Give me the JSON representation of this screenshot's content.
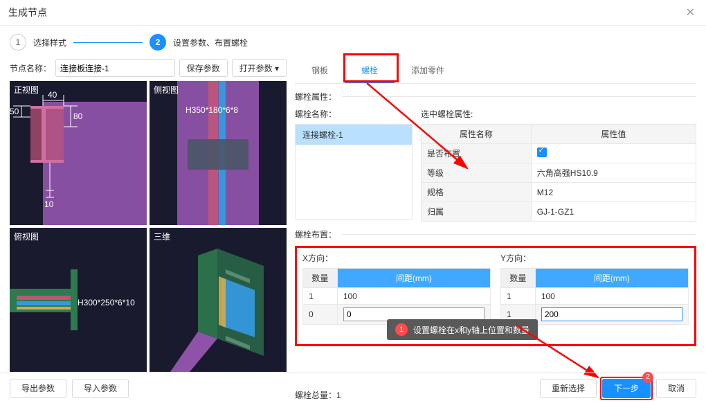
{
  "title": "生成节点",
  "steps": {
    "s1": {
      "num": "1",
      "label": "选择样式"
    },
    "s2": {
      "num": "2",
      "label": "设置参数、布置螺栓"
    }
  },
  "nodeName": {
    "label": "节点名称：",
    "value": "连接板连接-1",
    "save": "保存参数",
    "open": "打开参数 ▾"
  },
  "viewports": {
    "front": "正视图",
    "side": "侧视图",
    "top": "俯视图",
    "iso": "三维"
  },
  "dims": {
    "d50": "50",
    "d40": "40",
    "d80": "80",
    "d10": "10",
    "h350": "H350*180*6*8",
    "h300": "H300*250*6*10"
  },
  "tabs": {
    "plate": "钢板",
    "bolt": "螺栓",
    "add": "添加零件"
  },
  "boltProps": {
    "sectionTitle": "螺栓属性：",
    "nameLabel": "螺栓名称：",
    "selectedLabel": "选中螺栓属性:",
    "item": "连接螺栓-1",
    "headerName": "属性名称",
    "headerValue": "属性值",
    "rows": {
      "layout": {
        "k": "是否布置",
        "v": ""
      },
      "grade": {
        "k": "等级",
        "v": "六角高强HS10.9"
      },
      "spec": {
        "k": "规格",
        "v": "M12"
      },
      "belong": {
        "k": "归属",
        "v": "GJ-1-GZ1"
      }
    }
  },
  "boltLayout": {
    "sectionTitle": "螺栓布置：",
    "xLabel": "X方向：",
    "yLabel": "Y方向：",
    "qtyHeader": "数量",
    "distHeader": "间距(mm)",
    "x": [
      {
        "qty": "1",
        "dist": "100"
      },
      {
        "qty": "0",
        "dist": "0"
      }
    ],
    "y": [
      {
        "qty": "1",
        "dist": "100"
      },
      {
        "qty": "1",
        "dist": "200"
      }
    ],
    "callout": "设置螺栓在x和y轴上位置和数量",
    "calloutNum": "1",
    "total": "螺栓总量：1"
  },
  "footer": {
    "export": "导出参数",
    "import": "导入参数",
    "reselect": "重新选择",
    "next": "下一步",
    "cancel": "取消",
    "badge": "2"
  }
}
